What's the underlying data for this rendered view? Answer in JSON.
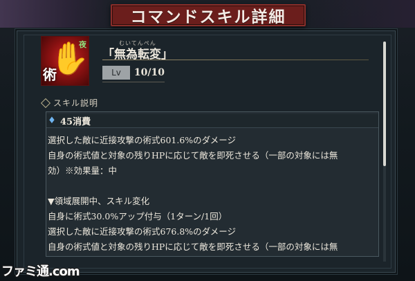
{
  "header": {
    "title": "コマンドスキル詳細"
  },
  "skill": {
    "name_ruby": "むいてんぺん",
    "name": "「無為転変」",
    "icon_kanji": "術",
    "icon_tag": "夜",
    "level_label": "Lv",
    "level_value": "10/10"
  },
  "section": {
    "title": "スキル説明"
  },
  "description": {
    "cost": "45消費",
    "lines": [
      "選択した敵に近接攻撃の術式601.6%のダメージ",
      "自身の術式値と対象の残りHPに応じて敵を即死させる（一部の対象には無",
      "効）※効果量：中",
      "",
      "▼領域展開中、スキル変化",
      "自身に術式30.0%アップ付与（1ターン/1回）",
      "選択した敵に近接攻撃の術式676.8%のダメージ",
      "自身の術式値と対象の残りHPに応じて敵を即死させる（一部の対象には無"
    ]
  },
  "watermark": {
    "text": "ファミ通.com"
  },
  "colors": {
    "banner": "#6b1e1c",
    "panel": "#1b242a",
    "cost_icon": "#6fb4f0"
  }
}
